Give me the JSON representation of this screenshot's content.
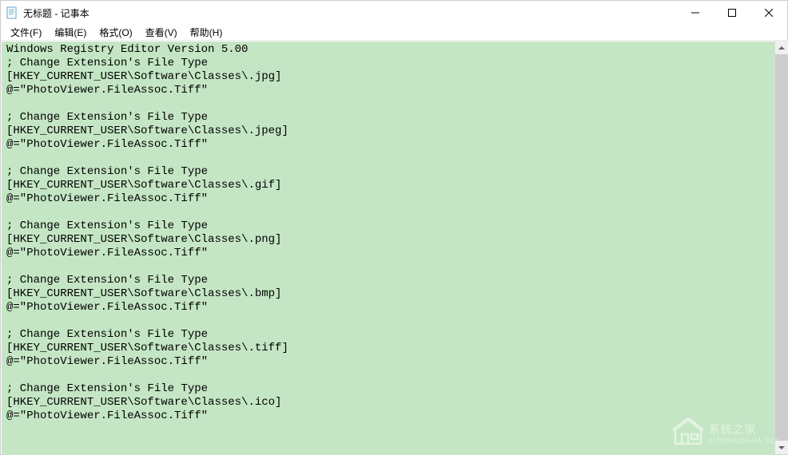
{
  "window": {
    "title": "无标题 - 记事本"
  },
  "menu": {
    "file": "文件(F)",
    "edit": "编辑(E)",
    "format": "格式(O)",
    "view": "查看(V)",
    "help": "帮助(H)"
  },
  "content": "Windows Registry Editor Version 5.00\n; Change Extension's File Type\n[HKEY_CURRENT_USER\\Software\\Classes\\.jpg]\n@=\"PhotoViewer.FileAssoc.Tiff\"\n\n; Change Extension's File Type\n[HKEY_CURRENT_USER\\Software\\Classes\\.jpeg]\n@=\"PhotoViewer.FileAssoc.Tiff\"\n\n; Change Extension's File Type\n[HKEY_CURRENT_USER\\Software\\Classes\\.gif]\n@=\"PhotoViewer.FileAssoc.Tiff\"\n\n; Change Extension's File Type\n[HKEY_CURRENT_USER\\Software\\Classes\\.png]\n@=\"PhotoViewer.FileAssoc.Tiff\"\n\n; Change Extension's File Type\n[HKEY_CURRENT_USER\\Software\\Classes\\.bmp]\n@=\"PhotoViewer.FileAssoc.Tiff\"\n\n; Change Extension's File Type\n[HKEY_CURRENT_USER\\Software\\Classes\\.tiff]\n@=\"PhotoViewer.FileAssoc.Tiff\"\n\n; Change Extension's File Type\n[HKEY_CURRENT_USER\\Software\\Classes\\.ico]\n@=\"PhotoViewer.FileAssoc.Tiff\"",
  "watermark": {
    "name": "系统之家",
    "url": "XITONGZHIJIA.NET"
  }
}
